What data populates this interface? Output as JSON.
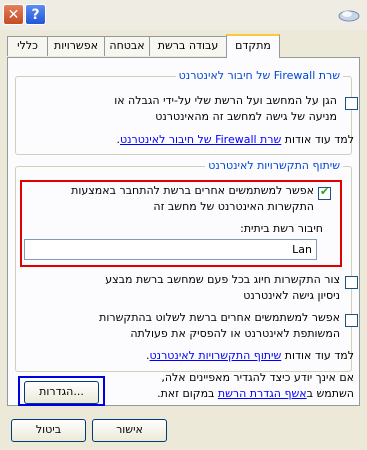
{
  "titlebar": {
    "close_icon": "close-icon",
    "help_label": "?"
  },
  "tabs": [
    {
      "label": "כללי"
    },
    {
      "label": "אפשרויות"
    },
    {
      "label": "אבטחה"
    },
    {
      "label": "עבודה ברשת"
    },
    {
      "label": "מתקדם",
      "active": true
    }
  ],
  "firewall": {
    "title": "שרת Firewall של חיבור לאינטרנט",
    "protect_line1": "הגן על המחשב ועל הרשת שלי על-ידי הגבלה או",
    "protect_line2": "מניעה של גישה למחשב זה מהאינטרנט",
    "learn_prefix": "למד עוד אודות",
    "learn_link": "שרת Firewall של חיבור לאינטרנט",
    "learn_suffix": "."
  },
  "sharing": {
    "title": "שיתוף התקשרויות לאינטרנט",
    "allow_line1": "אפשר למשתמשים אחרים ברשת להתחבר באמצעות",
    "allow_line2": "התקשרות האינטרנט של מחשב זה",
    "home_network_label": "חיבור רשת ביתית:",
    "home_network_value": "Lan",
    "dial_line1": "צור התקשרות חיוג בכל פעם שמחשב ברשת מבצע",
    "dial_line2": "ניסיון גישה לאינטרנט",
    "control_line1": "אפשר למשתמשים אחרים ברשת לשלוט בהתקשרות",
    "control_line2": "המשותפת לאינטרנט או להפסיק את פעולתה",
    "learn_prefix": "למד עוד אודות",
    "learn_link": "שיתוף התקשרויות לאינטרנט",
    "learn_suffix": "."
  },
  "footer": {
    "note_line1": "אם אינך יודע כיצד להגדיר מאפיינים אלה,",
    "note_line2_prefix": "השתמש ב",
    "note_link": "אשף הגדרת הרשת",
    "note_line2_suffix": " במקום זאת.",
    "settings_button": "הגדרות..."
  },
  "buttons": {
    "ok": "אישור",
    "cancel": "ביטול"
  }
}
